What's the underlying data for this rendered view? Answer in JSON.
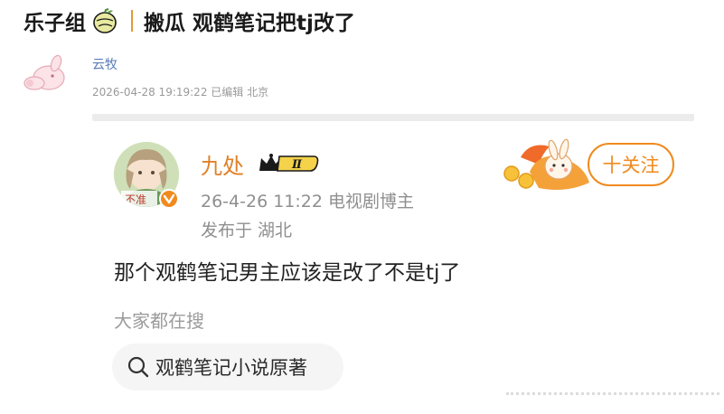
{
  "header": {
    "group_name": "乐子组",
    "post_title": "搬瓜 观鹤笔记把tj改了"
  },
  "author": {
    "name": "云牧",
    "meta": "2026-04-28 19:19:22 已编辑 北京"
  },
  "screenshot": {
    "user_name": "九处",
    "avatar_text": "不准",
    "level_badge": "Ⅱ",
    "meta_line1": "26-4-26 11:22  电视剧博主",
    "meta_line2": "发布于 湖北",
    "follow_label": "十关注",
    "body_text": "那个观鹤笔记男主应该是改了不是tj了",
    "hot_search_label": "大家都在搜",
    "search_query": "观鹤笔记小说原著"
  },
  "colors": {
    "accent_orange": "#f08a1e",
    "title_separator": "#e59a2f",
    "author_link": "#5b7db8",
    "meta_gray": "#9a9a9a"
  }
}
